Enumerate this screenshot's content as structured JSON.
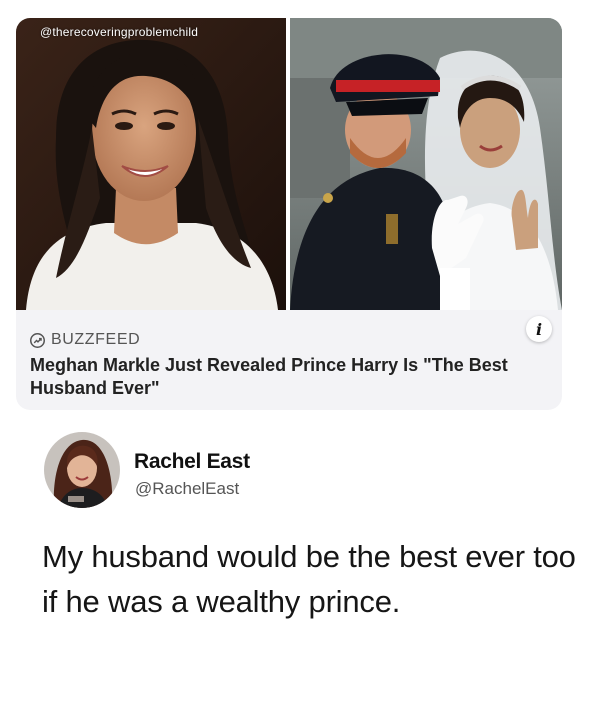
{
  "watermark": "@therecoveringproblemchild",
  "article": {
    "source": "BUZZFEED",
    "source_icon": "buzzfeed-trending-icon",
    "headline": "Meghan Markle Just Revealed Prince Harry Is \"The Best Husband Ever\"",
    "info_icon": "info-icon"
  },
  "tweet": {
    "author_name": "Rachel East",
    "author_handle": "@RachelEast",
    "text": "My husband would be the best ever too if he was a wealthy prince."
  },
  "colors": {
    "card_background": "#f3f3f6",
    "headline": "#222222",
    "source": "#555555",
    "tweet_text": "#161616"
  }
}
